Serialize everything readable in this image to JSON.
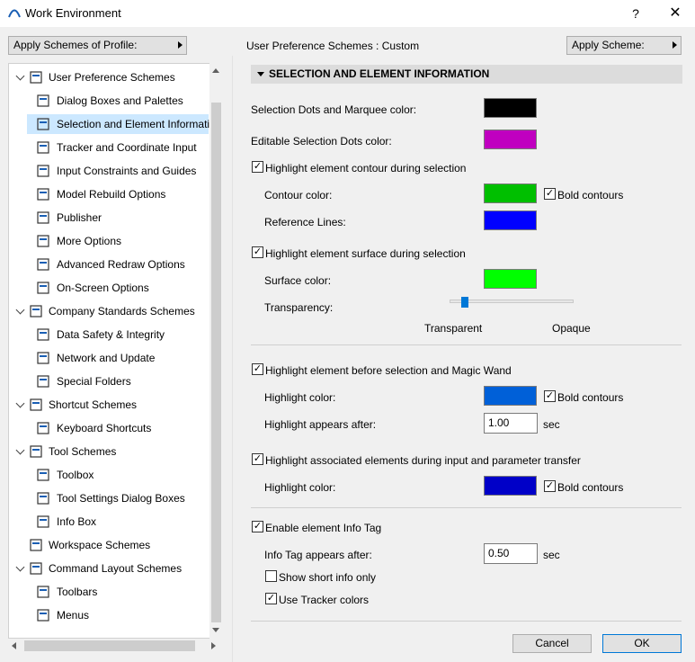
{
  "window": {
    "title": "Work Environment",
    "help_label": "?",
    "close_label": "✕"
  },
  "profile_button": "Apply Schemes of Profile:",
  "scheme_label": "User Preference Schemes :",
  "scheme_value": "Custom",
  "apply_scheme_button": "Apply Scheme:",
  "tree": [
    {
      "label": "User Preference Schemes",
      "icon": "user-pref-icon",
      "level": 0,
      "expanded": true
    },
    {
      "label": "Dialog Boxes and Palettes",
      "icon": "dialog-icon",
      "level": 1
    },
    {
      "label": "Selection and Element Informatic",
      "icon": "selection-icon",
      "level": 1,
      "selected": true
    },
    {
      "label": "Tracker and Coordinate Input",
      "icon": "xyz-icon",
      "level": 1
    },
    {
      "label": "Input Constraints and Guides",
      "icon": "mouse-icon",
      "level": 1
    },
    {
      "label": "Model Rebuild Options",
      "icon": "wall-icon",
      "level": 1
    },
    {
      "label": "Publisher",
      "icon": "publisher-icon",
      "level": 1
    },
    {
      "label": "More Options",
      "icon": "sliders-icon",
      "level": 1
    },
    {
      "label": "Advanced Redraw Options",
      "icon": "house-icon",
      "level": 1
    },
    {
      "label": "On-Screen Options",
      "icon": "monitor-icon",
      "level": 1
    },
    {
      "label": "Company Standards Schemes",
      "icon": "company-icon",
      "level": 0,
      "expanded": true
    },
    {
      "label": "Data Safety & Integrity",
      "icon": "data-safety-icon",
      "level": 1
    },
    {
      "label": "Network and Update",
      "icon": "globe-icon",
      "level": 1
    },
    {
      "label": "Special Folders",
      "icon": "folder-icon",
      "level": 1
    },
    {
      "label": "Shortcut Schemes",
      "icon": "shortcut-scheme-icon",
      "level": 0,
      "expanded": true
    },
    {
      "label": "Keyboard Shortcuts",
      "icon": "keyboard-shortcut-icon",
      "level": 1
    },
    {
      "label": "Tool Schemes",
      "icon": "tool-scheme-icon",
      "level": 0,
      "expanded": true
    },
    {
      "label": "Toolbox",
      "icon": "toolbox-icon",
      "level": 1
    },
    {
      "label": "Tool Settings Dialog Boxes",
      "icon": "tool-settings-icon",
      "level": 1
    },
    {
      "label": "Info Box",
      "icon": "info-box-icon",
      "level": 1
    },
    {
      "label": "Workspace Schemes",
      "icon": "workspace-icon",
      "level": 0
    },
    {
      "label": "Command Layout Schemes",
      "icon": "command-layout-icon",
      "level": 0,
      "expanded": true
    },
    {
      "label": "Toolbars",
      "icon": "toolbars-icon",
      "level": 1
    },
    {
      "label": "Menus",
      "icon": "menus-icon",
      "level": 1
    }
  ],
  "section_title": "SELECTION AND ELEMENT INFORMATION",
  "settings": {
    "dots_marquee_label": "Selection Dots and Marquee color:",
    "dots_marquee_color": "#000000",
    "editable_dots_label": "Editable Selection Dots color:",
    "editable_dots_color": "#c000c0",
    "contour_cb_label": "Highlight element contour during selection",
    "contour_cb": true,
    "contour_color_label": "Contour color:",
    "contour_color": "#00bf00",
    "bold_contours_label": "Bold contours",
    "bold_contours_1": true,
    "reference_lines_label": "Reference Lines:",
    "reference_lines_color": "#0000ff",
    "surface_cb_label": "Highlight element surface during selection",
    "surface_cb": true,
    "surface_color_label": "Surface color:",
    "surface_color": "#00ff00",
    "transparency_label": "Transparency:",
    "transparency_value": 0.1,
    "transparent_label": "Transparent",
    "opaque_label": "Opaque",
    "before_sel_cb_label": "Highlight element before selection and Magic Wand",
    "before_sel_cb": true,
    "highlight_color_label": "Highlight color:",
    "highlight_color": "#0060d8",
    "bold_contours_2": true,
    "highlight_after_label": "Highlight appears after:",
    "highlight_after_value": "1.00",
    "sec_label": "sec",
    "assoc_cb_label": "Highlight associated elements during input and parameter transfer",
    "assoc_cb": true,
    "assoc_color_label": "Highlight color:",
    "assoc_color": "#0000c8",
    "bold_contours_3": true,
    "info_tag_cb_label": "Enable element Info Tag",
    "info_tag_cb": true,
    "info_tag_after_label": "Info Tag appears after:",
    "info_tag_after_value": "0.50",
    "short_info_label": "Show short info only",
    "short_info": false,
    "tracker_colors_label": "Use Tracker colors",
    "tracker_colors": true
  },
  "footer": {
    "cancel_label": "Cancel",
    "ok_label": "OK"
  }
}
